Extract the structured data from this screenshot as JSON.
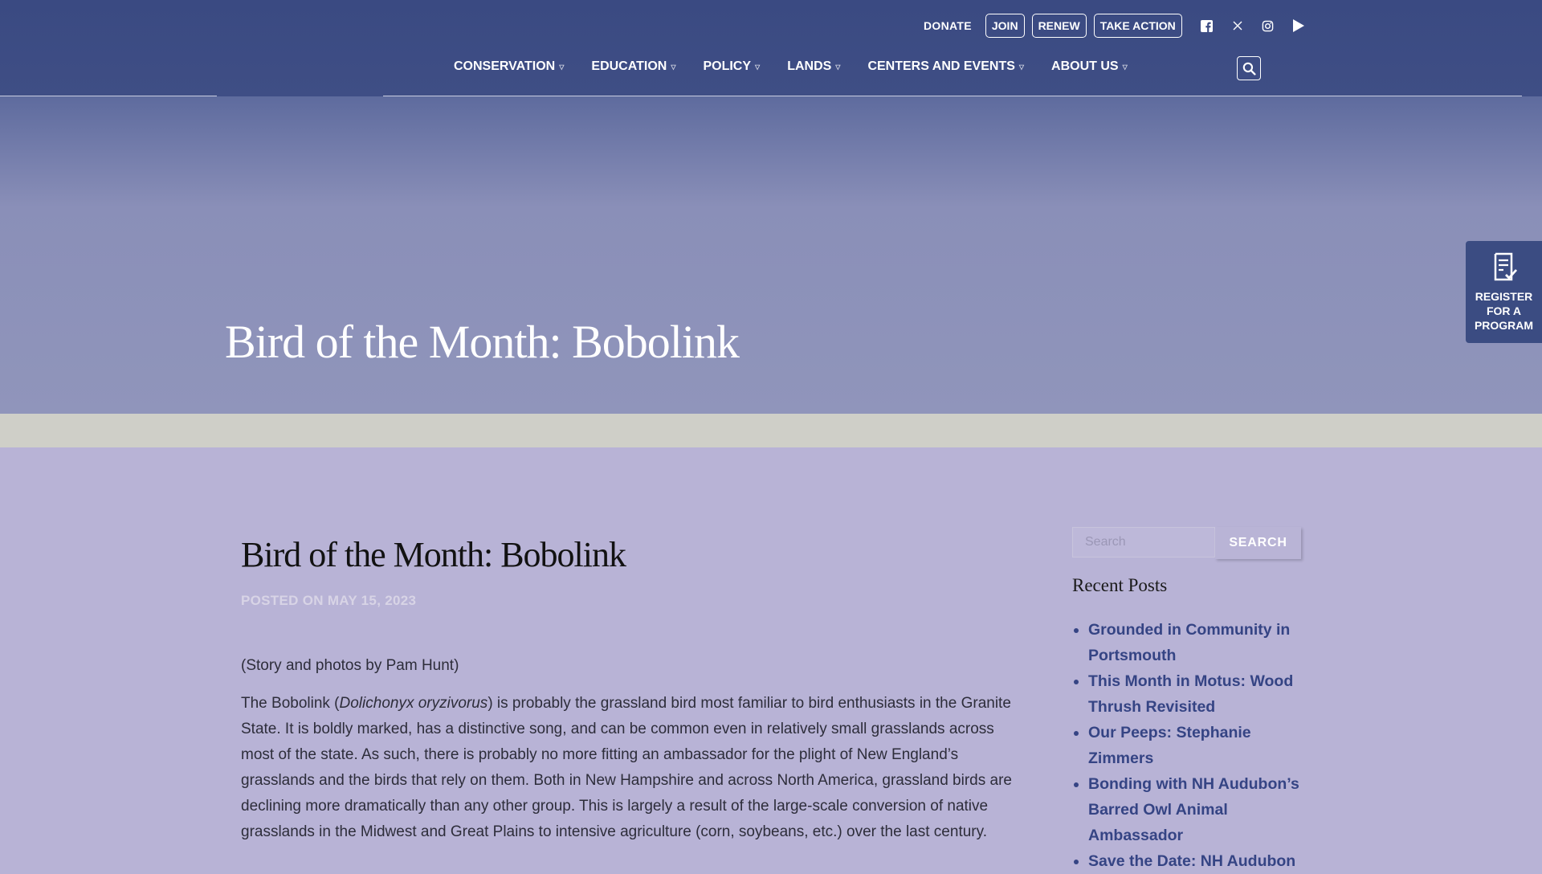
{
  "header": {
    "utility": {
      "donate": "DONATE",
      "join": "JOIN",
      "renew": "RENEW",
      "take_action": "TAKE ACTION"
    },
    "social_icons": [
      "facebook-icon",
      "x-icon",
      "instagram-icon",
      "youtube-icon"
    ],
    "nav": [
      {
        "label": "CONSERVATION"
      },
      {
        "label": "EDUCATION"
      },
      {
        "label": "POLICY"
      },
      {
        "label": "LANDS"
      },
      {
        "label": "CENTERS AND EVENTS"
      },
      {
        "label": "ABOUT US"
      }
    ]
  },
  "hero": {
    "title": "Bird of the Month: Bobolink"
  },
  "register": {
    "label": "REGISTER FOR A PROGRAM"
  },
  "article": {
    "title": "Bird of the Month: Bobolink",
    "posted": "POSTED ON MAY 15, 2023",
    "byline": "(Story and photos by Pam Hunt)",
    "para_start": "The Bobolink (",
    "para_italic": "Dolichonyx oryzivorus",
    "para_rest": ") is probably the grassland bird most familiar to bird enthusiasts in the Granite State. It is boldly marked, has a distinctive song, and can be common even in relatively small grasslands across most of the state. As such, there is probably no more fitting an ambassador for the plight of New England’s grasslands and the birds that rely on them. Both in New Hampshire and across North America, grassland birds are declining more dramatically than any other group. This is largely a result of the large-scale conversion of native grasslands in the Midwest and Great Plains to intensive agriculture (corn, soybeans, etc.) over the last century."
  },
  "sidebar": {
    "search_placeholder": "Search",
    "search_button": "SEARCH",
    "recent_heading": "Recent Posts",
    "recent_posts": [
      "Grounded in Community in Portsmouth",
      "This Month in Motus: Wood Thrush Revisited",
      "Our Peeps: Stephanie Zimmers",
      "Bonding with NH Audubon’s Barred Owl Animal Ambassador",
      "Save the Date: NH Audubon"
    ]
  },
  "colors": {
    "header_bg": "#3a4a82",
    "link": "#354484",
    "page_bg": "#b8b3d6"
  }
}
